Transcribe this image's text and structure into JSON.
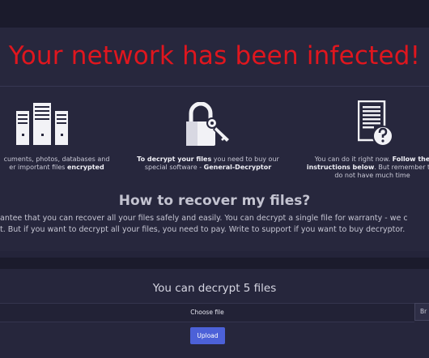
{
  "header": {
    "headline": "Your network has been infected!"
  },
  "features": [
    {
      "icon": "server-racks-icon",
      "line1": "cuments, photos, databases and",
      "line2_prefix": "er important files ",
      "line2_bold": "encrypted"
    },
    {
      "icon": "padlock-key-icon",
      "line1_bold": "To decrypt your files",
      "line1_rest": " you need to buy our",
      "line2_prefix": "special software - ",
      "line2_bold": "General-Decryptor"
    },
    {
      "icon": "document-question-icon",
      "line1_prefix": "You can do it right now. ",
      "line1_bold": "Follow the",
      "line2_bold": "instructions below",
      "line2_rest": ". But remember tha",
      "line3": "do not have much time"
    }
  ],
  "recovery": {
    "title": "How to recover my files?",
    "paragraph_line1": "antee that you can recover all your files safely and easily. You can decrypt a single file for warranty - we c",
    "paragraph_line2": "t. But if you want to decrypt all your files, you need to pay. Write to support if you want to buy decryptor."
  },
  "decrypt": {
    "title": "You can decrypt 5 files",
    "file_label": "Choose file",
    "browse_label": "Br",
    "upload_label": "Upload"
  },
  "colors": {
    "headline": "#e0161e",
    "background": "#24243a",
    "panel": "#27273d",
    "upload_button": "#4c61d8"
  }
}
